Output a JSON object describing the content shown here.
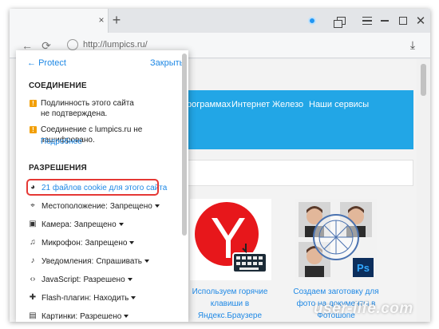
{
  "browser": {
    "tab_close": "×",
    "new_tab": "+",
    "url": "http://lumpics.ru/"
  },
  "panel": {
    "back_label": "Protect",
    "close_label": "Закрыть",
    "connection_heading": "СОЕДИНЕНИЕ",
    "warn1_line1": "Подлинность этого сайта",
    "warn1_line2": "не подтверждена.",
    "warn2": "Соединение с lumpics.ru не зашифровано.",
    "more_link": "Подробнее",
    "permissions_heading": "РАЗРЕШЕНИЯ",
    "cookies_link": "21 файлов cookie для этого сайта",
    "permissions": [
      {
        "label": "Местоположение:",
        "value": "Запрещено"
      },
      {
        "label": "Камера:",
        "value": "Запрещено"
      },
      {
        "label": "Микрофон:",
        "value": "Запрещено"
      },
      {
        "label": "Уведомления:",
        "value": "Спрашивать"
      },
      {
        "label": "JavaScript:",
        "value": "Разрешено"
      },
      {
        "label": "Flash-плагин:",
        "value": "Находить"
      },
      {
        "label": "Картинки:",
        "value": "Разрешено"
      }
    ]
  },
  "site": {
    "nav": [
      "рограммах",
      "Интернет",
      "Железо",
      "Наши сервисы"
    ],
    "cards": [
      {
        "caption_lines": [
          "Используем горячие",
          "клавиши в",
          "Яндекс.Браузере"
        ]
      },
      {
        "caption_lines": [
          "Создаем заготовку для",
          "фото на документы в",
          "Фотошопе"
        ]
      }
    ]
  },
  "watermark": "user-life.com"
}
